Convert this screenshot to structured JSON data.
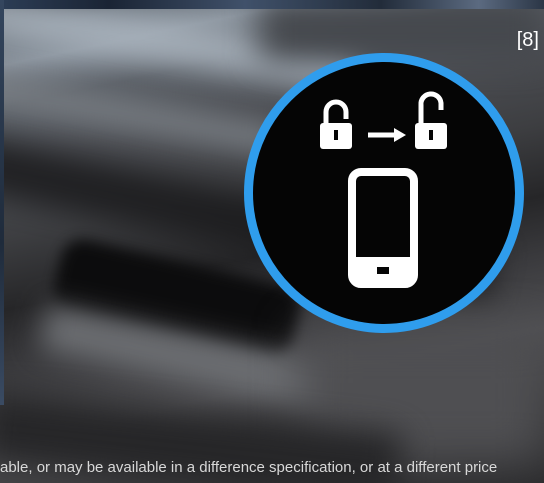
{
  "footnote_marker": "[8]",
  "caption": "able, or may be available in a difference specification, or at a different price",
  "feature_badge": {
    "icons": {
      "locked": "lock-closed-icon",
      "arrow": "arrow-right-icon",
      "unlocked": "lock-open-icon",
      "device": "smartphone-icon"
    }
  },
  "colors": {
    "ring": "#2f9ded",
    "badge_fill": "#050505",
    "icon": "#ffffff",
    "caption_text": "#d8d8d8"
  }
}
